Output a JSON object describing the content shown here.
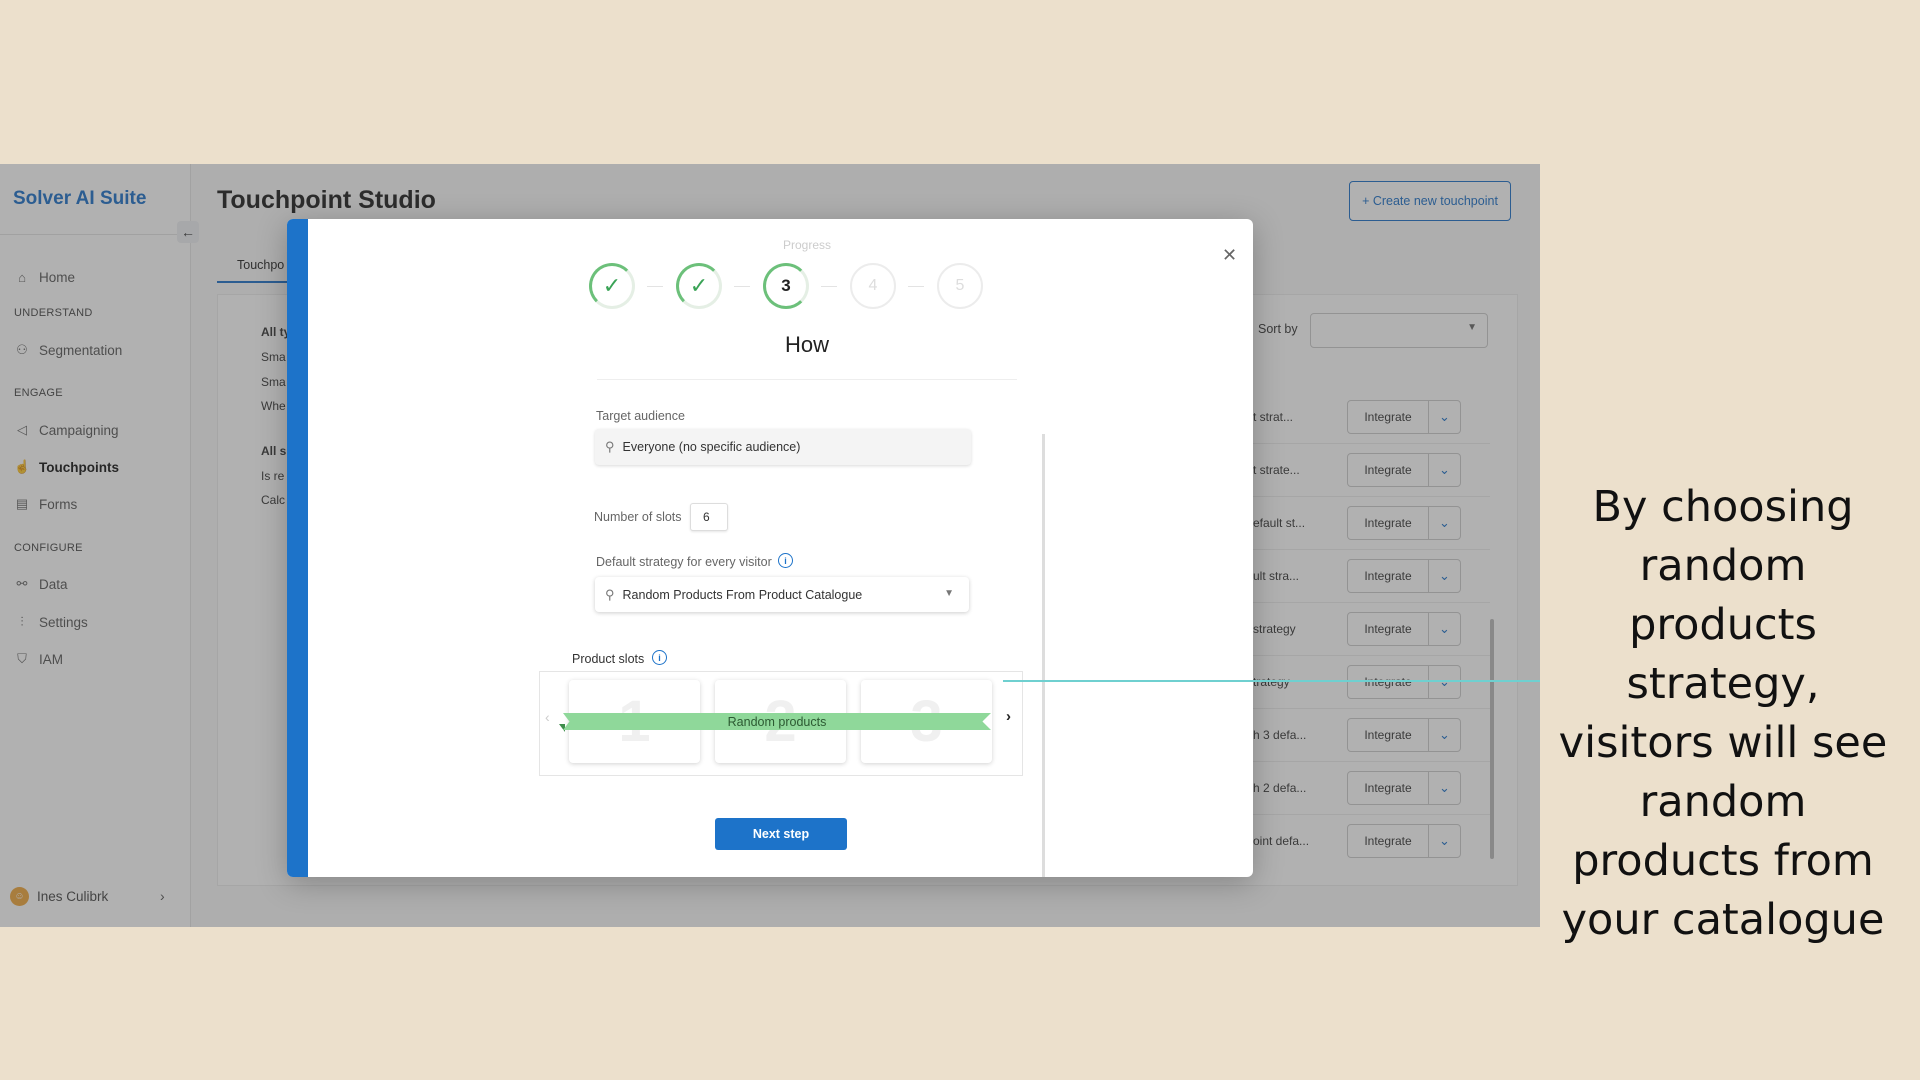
{
  "sidebar": {
    "brand": "Solver AI Suite",
    "collapse_icon": "arrow-left-icon",
    "items": [
      {
        "label": "Home",
        "icon": "home-icon"
      },
      {
        "section": "UNDERSTAND"
      },
      {
        "label": "Segmentation",
        "icon": "users-icon"
      },
      {
        "section": "ENGAGE"
      },
      {
        "label": "Campaigning",
        "icon": "megaphone-icon"
      },
      {
        "label": "Touchpoints",
        "icon": "hand-pointer-icon",
        "active": true
      },
      {
        "label": "Forms",
        "icon": "clipboard-icon"
      },
      {
        "section": "CONFIGURE"
      },
      {
        "label": "Data",
        "icon": "data-icon"
      },
      {
        "label": "Settings",
        "icon": "sliders-icon"
      },
      {
        "label": "IAM",
        "icon": "shield-icon"
      }
    ],
    "home": "Home",
    "understand": "UNDERSTAND",
    "segmentation": "Segmentation",
    "engage": "ENGAGE",
    "campaigning": "Campaigning",
    "touchpoints": "Touchpoints",
    "forms": "Forms",
    "configure": "CONFIGURE",
    "data": "Data",
    "settings": "Settings",
    "iam": "IAM",
    "user_name": "Ines Culibrk"
  },
  "header": {
    "title": "Touchpoint Studio",
    "create_button": "+ Create new touchpoint",
    "tab": "Touchpo"
  },
  "filters": {
    "group1_title": "All ty",
    "group1_items": [
      "Sma",
      "Sma",
      "Whe"
    ],
    "group2_title": "All s",
    "group2_items": [
      "Is re",
      "Calc"
    ],
    "sort_label": "Sort by"
  },
  "table": {
    "integrate_label": "Integrate",
    "rows": [
      "t strat...",
      "t strate...",
      "efault st...",
      "ult stra...",
      "strategy",
      "trategy",
      "h 3 defa...",
      "h 2 defa...",
      "oint defa..."
    ]
  },
  "modal": {
    "progress_label": "Progress",
    "steps": [
      {
        "state": "done",
        "label": "✓"
      },
      {
        "state": "done",
        "label": "✓"
      },
      {
        "state": "current",
        "label": "3"
      },
      {
        "state": "future",
        "label": "4"
      },
      {
        "state": "future",
        "label": "5"
      }
    ],
    "heading": "How",
    "target_audience_label": "Target audience",
    "target_audience_value": "Everyone (no specific audience)",
    "slots_label": "Number of slots",
    "slots_value": "6",
    "strategy_label": "Default strategy for every visitor",
    "strategy_value": "Random Products From Product Catalogue",
    "product_slots_label": "Product slots",
    "slots": [
      "1",
      "2",
      "3"
    ],
    "ribbon_label": "Random products",
    "next_button": "Next step"
  },
  "callout": {
    "text": "By choosing random products strategy, visitors will see random products from your catalogue"
  },
  "colors": {
    "accent": "#1d73c9",
    "success": "#6cc07a",
    "ribbon": "#8fd89a",
    "background": "#ece0cc",
    "callout_line": "#6fd0d0"
  }
}
